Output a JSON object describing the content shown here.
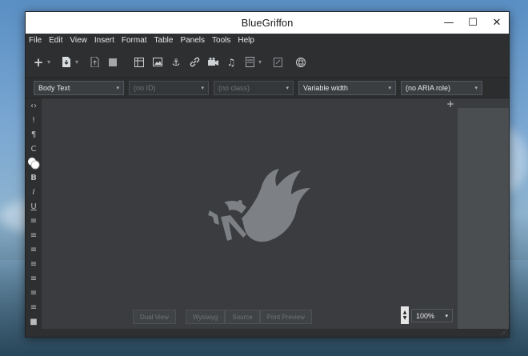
{
  "window": {
    "title": "BlueGriffon",
    "minimize": "—",
    "maximize": "☐",
    "close": "✕"
  },
  "menu": [
    "File",
    "Edit",
    "View",
    "Insert",
    "Format",
    "Table",
    "Panels",
    "Tools",
    "Help"
  ],
  "format_bar": {
    "paragraph_style": "Body Text",
    "id_placeholder": "(no ID)",
    "class_placeholder": "(no class)",
    "width": "Variable width",
    "aria_role": "(no ARIA role)"
  },
  "sidebar_icons": [
    "‹›",
    "!",
    "¶",
    "C",
    "●",
    "B",
    "I",
    "U",
    "≡",
    "≡",
    "≡",
    "≡",
    "≡",
    "≡",
    "≡",
    "■"
  ],
  "view_tabs": [
    "Dual View",
    "Wysiwyg",
    "Source",
    "Print Preview"
  ],
  "zoom": {
    "value": "100%"
  },
  "colors": {
    "window_bg": "#3a3c3f",
    "chrome_bg": "#2d2f31",
    "text": "#e6e6e6"
  }
}
